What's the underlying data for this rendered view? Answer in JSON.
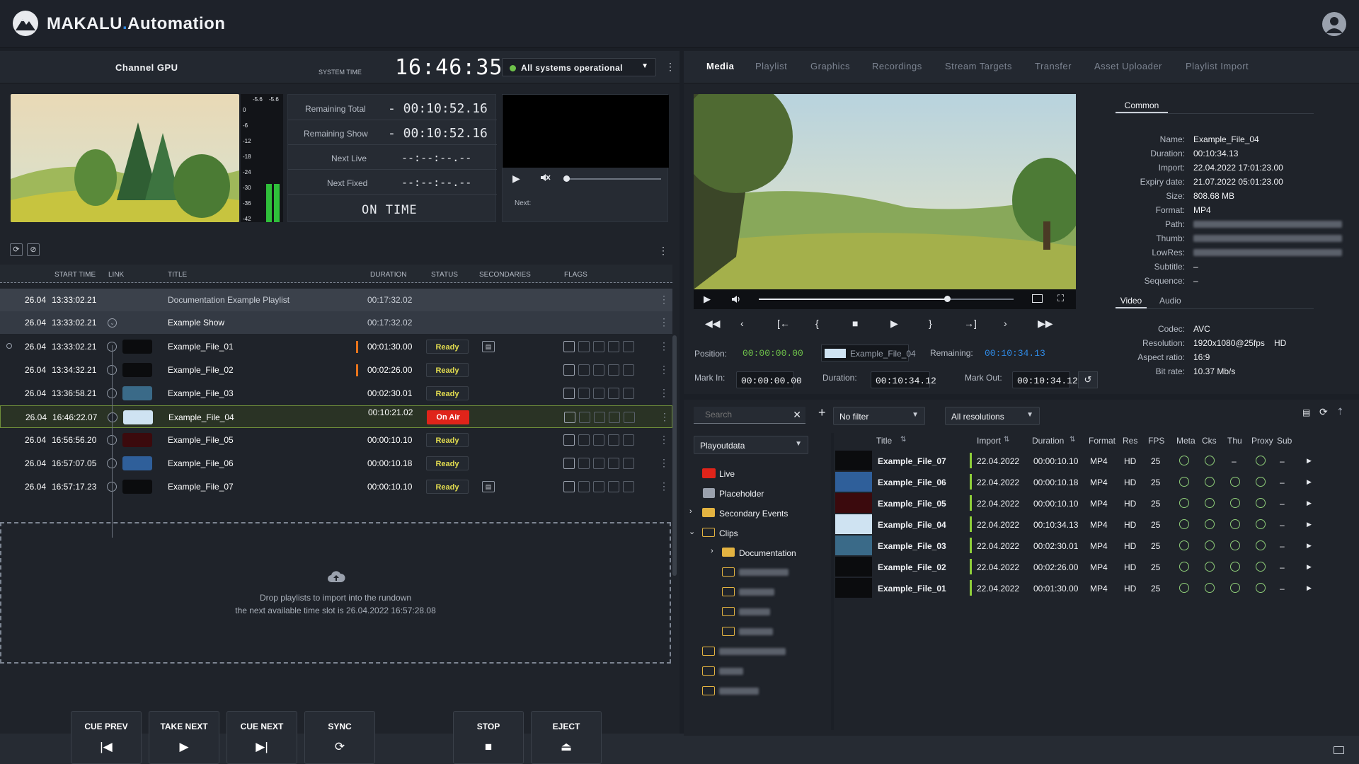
{
  "app": {
    "brand_main": "MAKALU",
    "brand_dot": ".",
    "brand_sub": "Automation"
  },
  "channel": {
    "name": "Channel GPU",
    "system_time_label": "SYSTEM TIME",
    "system_time": "16:46:35",
    "status_text": "All systems operational",
    "remaining_total_label": "Remaining Total",
    "remaining_total": "- 00:10:52.16",
    "remaining_show_label": "Remaining Show",
    "remaining_show": "- 00:10:52.16",
    "next_live_label": "Next Live",
    "next_live": "--:--:--.--",
    "next_fixed_label": "Next Fixed",
    "next_fixed": "--:--:--.--",
    "on_time": "ON TIME",
    "next_label": "Next:"
  },
  "meter": {
    "peak_left": "-5.6",
    "peak_right": "-5.6",
    "scale": [
      "0",
      "-6",
      "-12",
      "-18",
      "-24",
      "-30",
      "-36",
      "-42"
    ],
    "level_left": 0.3,
    "level_right": 0.3
  },
  "rundown": {
    "columns": [
      "START TIME",
      "LINK",
      "TITLE",
      "DURATION",
      "STATUS",
      "SECONDARIES",
      "FLAGS"
    ],
    "playlist_row": {
      "date": "26.04",
      "time": "13:33:02.21",
      "title": "Documentation Example Playlist",
      "duration": "00:17:32.02"
    },
    "show_row": {
      "date": "26.04",
      "time": "13:33:02.21",
      "title": "Example Show",
      "duration": "00:17:32.02"
    },
    "items": [
      {
        "date": "26.04",
        "time": "13:33:02.21",
        "title": "Example_File_01",
        "duration": "00:01:30.00",
        "status": "Ready"
      },
      {
        "date": "26.04",
        "time": "13:34:32.21",
        "title": "Example_File_02",
        "duration": "00:02:26.00",
        "status": "Ready"
      },
      {
        "date": "26.04",
        "time": "13:36:58.21",
        "title": "Example_File_03",
        "duration": "00:02:30.01",
        "status": "Ready"
      },
      {
        "date": "26.04",
        "time": "16:46:22.07",
        "title": "Example_File_04",
        "duration": "00:10:21.02",
        "status": "On Air"
      },
      {
        "date": "26.04",
        "time": "16:56:56.20",
        "title": "Example_File_05",
        "duration": "00:00:10.10",
        "status": "Ready"
      },
      {
        "date": "26.04",
        "time": "16:57:07.05",
        "title": "Example_File_06",
        "duration": "00:00:10.18",
        "status": "Ready"
      },
      {
        "date": "26.04",
        "time": "16:57:17.23",
        "title": "Example_File_07",
        "duration": "00:00:10.10",
        "status": "Ready"
      }
    ],
    "drop_line1": "Drop playlists to import into the rundown",
    "drop_line2": "the next available time slot is 26.04.2022 16:57:28.08"
  },
  "controls": {
    "cue_prev": "CUE PREV",
    "take_next": "TAKE NEXT",
    "cue_next": "CUE NEXT",
    "sync": "SYNC",
    "stop": "STOP",
    "eject": "EJECT"
  },
  "tabs": [
    "Media",
    "Playlist",
    "Graphics",
    "Recordings",
    "Stream Targets",
    "Transfer",
    "Asset Uploader",
    "Playlist Import"
  ],
  "preview": {
    "position_label": "Position:",
    "position": "00:00:00.00",
    "file_label": "Example_File_04",
    "remaining_label": "Remaining:",
    "remaining": "00:10:34.13",
    "mark_in_label": "Mark In:",
    "mark_in": "00:00:00.00",
    "duration_label": "Duration:",
    "duration": "00:10:34.12",
    "mark_out_label": "Mark Out:",
    "mark_out": "00:10:34.12",
    "scrub_progress": 0.74
  },
  "info": {
    "tab_common": "Common",
    "name_label": "Name:",
    "name": "Example_File_04",
    "duration_label": "Duration:",
    "duration": "00:10:34.13",
    "import_label": "Import:",
    "import": "22.04.2022 17:01:23.00",
    "expiry_label": "Expiry date:",
    "expiry": "21.07.2022 05:01:23.00",
    "size_label": "Size:",
    "size": "808.68 MB",
    "format_label": "Format:",
    "format": "MP4",
    "path_label": "Path:",
    "thumb_label": "Thumb:",
    "lowres_label": "LowRes:",
    "subtitle_label": "Subtitle:",
    "subtitle": "–",
    "sequence_label": "Sequence:",
    "sequence": "–",
    "tab_video": "Video",
    "tab_audio": "Audio",
    "codec_label": "Codec:",
    "codec": "AVC",
    "resolution_label": "Resolution:",
    "resolution": "1920x1080@25fps",
    "resolution_badge": "HD",
    "aspect_label": "Aspect ratio:",
    "aspect": "16:9",
    "bitrate_label": "Bit rate:",
    "bitrate": "10.37 Mb/s"
  },
  "library": {
    "search_placeholder": "Search",
    "filter": "No filter",
    "resolutions": "All resolutions",
    "source": "Playoutdata",
    "tree": {
      "live": "Live",
      "placeholder": "Placeholder",
      "secondary": "Secondary Events",
      "clips": "Clips",
      "documentation": "Documentation"
    },
    "columns": [
      "Title",
      "Import",
      "Duration",
      "Format",
      "Res",
      "FPS",
      "Meta",
      "Cks",
      "Thu",
      "Proxy",
      "Sub"
    ],
    "rows": [
      {
        "title": "Example_File_07",
        "import": "22.04.2022",
        "duration": "00:00:10.10",
        "format": "MP4",
        "res": "HD",
        "fps": "25",
        "thu": "–",
        "sub": "–"
      },
      {
        "title": "Example_File_06",
        "import": "22.04.2022",
        "duration": "00:00:10.18",
        "format": "MP4",
        "res": "HD",
        "fps": "25",
        "thu": "",
        "sub": "–"
      },
      {
        "title": "Example_File_05",
        "import": "22.04.2022",
        "duration": "00:00:10.10",
        "format": "MP4",
        "res": "HD",
        "fps": "25",
        "thu": "",
        "sub": "–"
      },
      {
        "title": "Example_File_04",
        "import": "22.04.2022",
        "duration": "00:10:34.13",
        "format": "MP4",
        "res": "HD",
        "fps": "25",
        "thu": "",
        "sub": "–"
      },
      {
        "title": "Example_File_03",
        "import": "22.04.2022",
        "duration": "00:02:30.01",
        "format": "MP4",
        "res": "HD",
        "fps": "25",
        "thu": "",
        "sub": "–"
      },
      {
        "title": "Example_File_02",
        "import": "22.04.2022",
        "duration": "00:02:26.00",
        "format": "MP4",
        "res": "HD",
        "fps": "25",
        "thu": "",
        "sub": "–"
      },
      {
        "title": "Example_File_01",
        "import": "22.04.2022",
        "duration": "00:01:30.00",
        "format": "MP4",
        "res": "HD",
        "fps": "25",
        "thu": "",
        "sub": "–"
      }
    ]
  },
  "colors": {
    "accent": "#2f8ae5",
    "ready": "#e3dd4f",
    "on_air": "#e0241a",
    "ok": "#8fcf79",
    "folder": "#e3b341",
    "position": "#6ec14a"
  }
}
